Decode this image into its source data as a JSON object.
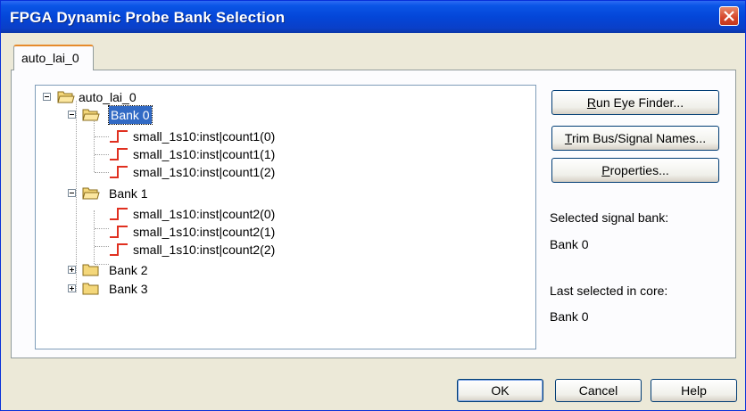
{
  "window": {
    "title": "FPGA Dynamic Probe Bank Selection"
  },
  "tabs": [
    {
      "label": "auto_lai_0"
    }
  ],
  "tree": {
    "root": "auto_lai_0",
    "banks": [
      {
        "label": "Bank 0",
        "signals": [
          "small_1s10:inst|count1(0)",
          "small_1s10:inst|count1(1)",
          "small_1s10:inst|count1(2)"
        ]
      },
      {
        "label": "Bank 1",
        "signals": [
          "small_1s10:inst|count2(0)",
          "small_1s10:inst|count2(1)",
          "small_1s10:inst|count2(2)"
        ]
      },
      {
        "label": "Bank 2"
      },
      {
        "label": "Bank 3"
      }
    ]
  },
  "buttons": {
    "run_eye_finder": {
      "mnemonic": "R",
      "rest": "un Eye Finder..."
    },
    "trim_names": {
      "mnemonic": "T",
      "rest": "rim Bus/Signal Names..."
    },
    "properties": {
      "mnemonic": "P",
      "rest": "roperties..."
    },
    "ok": "OK",
    "cancel": "Cancel",
    "help": "Help"
  },
  "info": {
    "selected_label": "Selected signal bank:",
    "selected_value": "Bank 0",
    "last_label": "Last selected in core:",
    "last_value": "Bank 0"
  },
  "colors": {
    "title_bar": "#0446d8",
    "selection": "#316ac5",
    "signal_icon": "#e03020"
  }
}
